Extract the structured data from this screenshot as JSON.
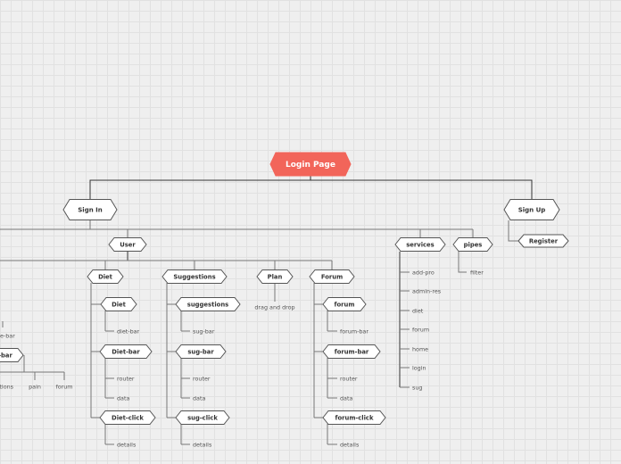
{
  "colors": {
    "root_fill": "#f2655a",
    "node_fill": "#ffffff",
    "node_stroke": "#555555",
    "line": "#777777",
    "line_dark": "#333333"
  },
  "nodes": {
    "root": "Login Page",
    "sign_in": "Sign In",
    "sign_up": "Sign Up",
    "user": "User",
    "services": "services",
    "pipes": "pipes",
    "register": "Register",
    "diet_group": "Diet",
    "suggestions_group": "Suggestions",
    "plan": "Plan",
    "forum_group": "Forum",
    "diet": "Diet",
    "diet_bar": "Diet-bar",
    "diet_click": "Diet-click",
    "suggestions": "suggestions",
    "sug_bar": "sug-bar",
    "sug_click": "sug-click",
    "forum": "forum",
    "forum_bar": "forum-bar",
    "forum_click": "forum-click",
    "partial_bar": "-bar"
  },
  "leaves": {
    "diet_bar_leaf": "diet-bar",
    "diet_router": "router",
    "diet_data": "data",
    "diet_details": "details",
    "sug_bar_leaf": "sug-bar",
    "sug_router": "router",
    "sug_data": "data",
    "sug_details": "details",
    "drag_drop": "drag and drop",
    "forum_bar_leaf": "forum-bar",
    "forum_router": "router",
    "forum_data": "data",
    "forum_details": "details",
    "filter": "filter",
    "services_items": [
      "add-pro",
      "admin-res",
      "diet",
      "forum",
      "home",
      "login",
      "sug"
    ],
    "partial_page_bar": "e-bar",
    "partial_options": "tions",
    "pain": "pain",
    "left_forum": "forum"
  }
}
